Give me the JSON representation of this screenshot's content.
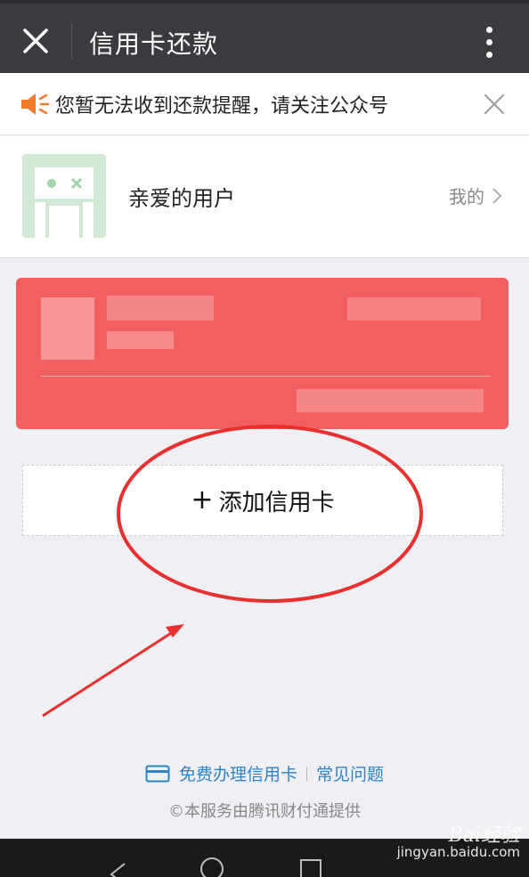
{
  "header": {
    "title": "信用卡还款",
    "close_icon": "close-icon",
    "more_icon": "more-vertical-icon",
    "background": "#3a3a3f"
  },
  "notice": {
    "text": "您暂无法收到还款提醒，请关注公众号",
    "speaker_icon": "speaker-icon",
    "speaker_color": "#f07b2d",
    "close_icon": "close-icon"
  },
  "user": {
    "name": "亲爱的用户",
    "mine_label": "我的",
    "avatar_color": "#cfe9d3"
  },
  "card": {
    "color": "#f25f60",
    "content": "blurred"
  },
  "add_card": {
    "plus": "+",
    "label": "添加信用卡"
  },
  "footer": {
    "apply_link": "免费办理信用卡",
    "faq_link": "常见问题",
    "copyright": "©本服务由腾讯财付通提供",
    "link_color": "#2e83c4"
  },
  "watermark": {
    "brand": "Bai经验",
    "url": "jingyan.baidu.com"
  },
  "annotation": {
    "color": "#e8312f"
  }
}
